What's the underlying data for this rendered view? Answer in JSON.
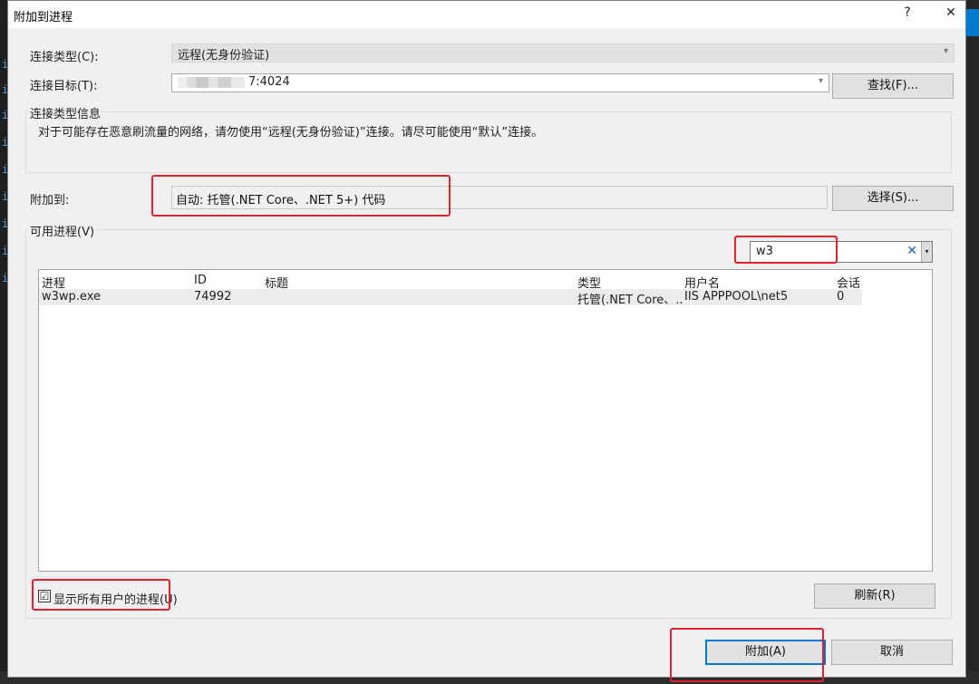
{
  "dialog": {
    "title": "附加到进程",
    "help_label": "?",
    "close_label": "✕"
  },
  "connection": {
    "type_label": "连接类型(C):",
    "type_value": "远程(无身份验证)",
    "target_label": "连接目标(T):",
    "target_value": "7:4024",
    "find_button": "查找(F)...",
    "info_group_label": "连接类型信息",
    "info_text": "对于可能存在恶意刷流量的网络，请勿使用“远程(无身份验证)”连接。请尽可能使用“默认”连接。"
  },
  "attach_to": {
    "label": "附加到:",
    "value": "自动: 托管(.NET Core、.NET 5+) 代码",
    "select_button": "选择(S)..."
  },
  "processes": {
    "group_label": "可用进程(V)",
    "filter_value": "w3",
    "clear_icon": "✕",
    "dropdown_icon": "▾",
    "columns": [
      "进程",
      "ID",
      "标题",
      "类型",
      "用户名",
      "会话"
    ],
    "rows": [
      {
        "process": "w3wp.exe",
        "id": "74992",
        "title": "",
        "type": "托管(.NET Core、...",
        "user": "IIS APPPOOL\\net5",
        "session": "0"
      }
    ],
    "show_all_label": "显示所有用户的进程(U)",
    "show_all_checked": true,
    "check_mark": "☑",
    "refresh_button": "刷新(R)"
  },
  "footer": {
    "attach_button": "附加(A)",
    "cancel_button": "取消"
  },
  "highlight_color": "#e0202a",
  "accent_color": "#0078d7"
}
